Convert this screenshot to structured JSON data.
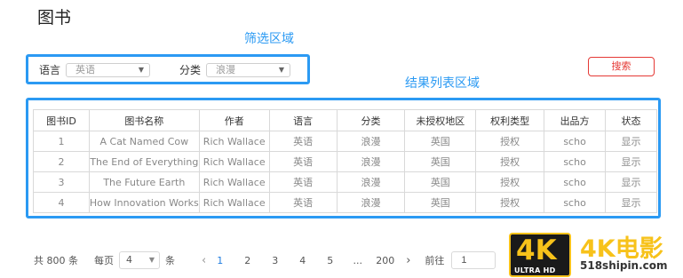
{
  "page": {
    "title": "图书"
  },
  "annotations": {
    "filter_area": "筛选区域",
    "results_area": "结果列表区域"
  },
  "filters": {
    "language": {
      "label": "语言",
      "value": "英语"
    },
    "category": {
      "label": "分类",
      "value": "浪漫"
    }
  },
  "search_button": "搜索",
  "table": {
    "headers": [
      "图书ID",
      "图书名称",
      "作者",
      "语言",
      "分类",
      "未授权地区",
      "权利类型",
      "出品方",
      "状态"
    ],
    "rows": [
      [
        "1",
        "A Cat Named Cow",
        "Rich Wallace",
        "英语",
        "浪漫",
        "英国",
        "授权",
        "scho",
        "显示"
      ],
      [
        "2",
        "The End of Everything",
        "Rich Wallace",
        "英语",
        "浪漫",
        "英国",
        "授权",
        "scho",
        "显示"
      ],
      [
        "3",
        "The Future Earth",
        "Rich Wallace",
        "英语",
        "浪漫",
        "英国",
        "授权",
        "scho",
        "显示"
      ],
      [
        "4",
        "How Innovation Works",
        "Rich Wallace",
        "英语",
        "浪漫",
        "英国",
        "授权",
        "scho",
        "显示"
      ]
    ]
  },
  "pagination": {
    "total_text": "共 800 条",
    "per_page_label": "每页",
    "per_page_value": "4",
    "per_page_unit": "条",
    "prev_icon": "‹",
    "pages": [
      "1",
      "2",
      "3",
      "4",
      "5",
      "...",
      "200"
    ],
    "current_page": "1",
    "next_icon": "›",
    "goto_label": "前往",
    "goto_value": "1"
  },
  "watermark": {
    "badge_text": "4K",
    "badge_sub": "ULTRA HD",
    "brand": "4K电影",
    "url": "518shipin.com"
  },
  "colors": {
    "annotation_blue": "#2b9af3",
    "search_red": "#e53935",
    "watermark_gold": "#f7c21a"
  }
}
